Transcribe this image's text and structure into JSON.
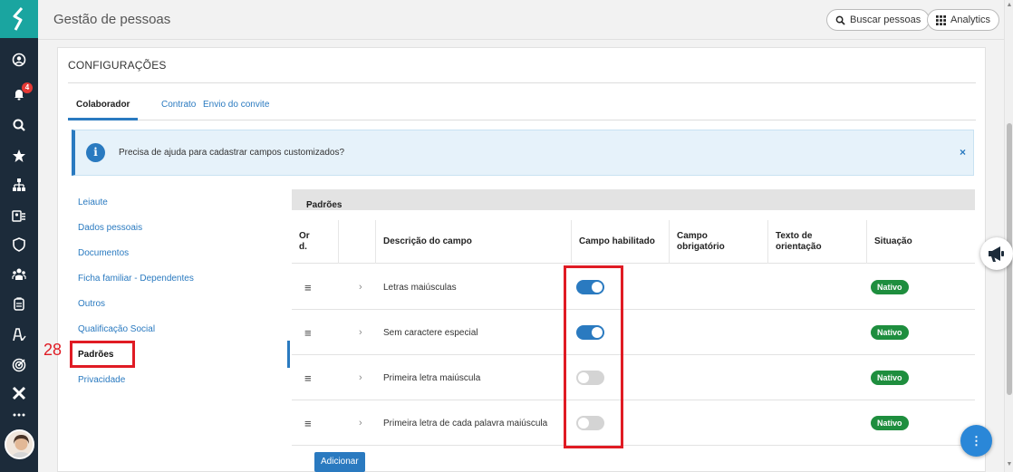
{
  "header": {
    "title": "Gestão de pessoas",
    "search_label": "Buscar pessoas",
    "analytics_label": "Analytics"
  },
  "rail": {
    "notification_count": "4",
    "icons": [
      "logo-icon",
      "user-circle-icon",
      "bell-icon",
      "search-icon",
      "star-icon",
      "org-chart-icon",
      "id-card-icon",
      "shield-icon",
      "team-icon",
      "building-icon",
      "person-check-icon",
      "target-icon",
      "x-icon",
      "more-icon"
    ]
  },
  "page": {
    "section_title": "CONFIGURAÇÕES",
    "tabs": [
      {
        "label": "Colaborador",
        "active": true
      },
      {
        "label": "Contrato",
        "active": false
      },
      {
        "label": "Envio do convite",
        "active": false
      }
    ],
    "alert": {
      "icon": "i",
      "text": "Precisa de ajuda para cadastrar campos customizados?",
      "close": "×"
    }
  },
  "subnav": {
    "items": [
      {
        "label": "Leiaute"
      },
      {
        "label": "Dados pessoais"
      },
      {
        "label": "Documentos"
      },
      {
        "label": "Ficha familiar - Dependentes"
      },
      {
        "label": "Outros"
      },
      {
        "label": "Qualificação Social"
      },
      {
        "label": "Padrões",
        "active": true
      },
      {
        "label": "Privacidade"
      }
    ]
  },
  "annotation": {
    "number": "28",
    "color": "#e01b24"
  },
  "table": {
    "group_title": "Padrões",
    "group_toggle": "−",
    "columns": {
      "ord": "Or d.",
      "ord_line1": "Or",
      "ord_line2": "d.",
      "descricao": "Descrição do campo",
      "habilitado": "Campo habilitado",
      "obrigatorio_line1": "Campo",
      "obrigatorio_line2": "obrigatório",
      "orientacao_line1": "Texto de",
      "orientacao_line2": "orientação",
      "situacao": "Situação"
    },
    "rows": [
      {
        "descricao": "Letras maiúsculas",
        "habilitado": true,
        "situacao": "Nativo"
      },
      {
        "descricao": "Sem caractere especial",
        "habilitado": true,
        "situacao": "Nativo"
      },
      {
        "descricao": "Primeira letra maiúscula",
        "habilitado": false,
        "situacao": "Nativo"
      },
      {
        "descricao": "Primeira letra de cada palavra maiúscula",
        "habilitado": false,
        "situacao": "Nativo"
      }
    ],
    "add_label": "Adicionar"
  },
  "colors": {
    "accent": "#2a7ac0",
    "rail_bg": "#1c2b3a",
    "logo_bg": "#1aa5a0",
    "status_green": "#1e8e3e",
    "annotation_red": "#e01b24"
  }
}
